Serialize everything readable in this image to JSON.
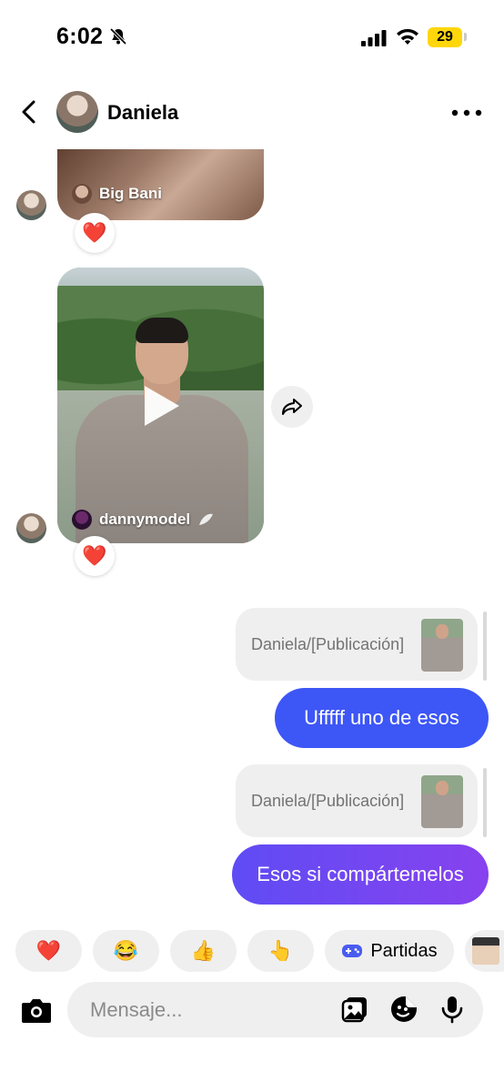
{
  "status_bar": {
    "time": "6:02",
    "battery": "29"
  },
  "header": {
    "contact_name": "Daniela"
  },
  "thread": {
    "shared_post_1": {
      "author": "Big Bani",
      "reaction": "❤️"
    },
    "shared_post_2": {
      "author": "dannymodel",
      "reaction": "❤️"
    },
    "sent_quote_1": {
      "text": "Daniela/[Publicación]"
    },
    "sent_message_1": {
      "text": "Ufffff uno de esos"
    },
    "sent_quote_2": {
      "text": "Daniela/[Publicación]"
    },
    "sent_message_2": {
      "text": "Esos si compártemelos"
    }
  },
  "quick_replies": {
    "items": [
      {
        "emoji": "❤️"
      },
      {
        "emoji": "😂"
      },
      {
        "emoji": "👍"
      },
      {
        "emoji": "👆"
      }
    ],
    "games_label": "Partidas"
  },
  "composer": {
    "placeholder": "Mensaje..."
  },
  "colors": {
    "bubble_gradient_start": "#3a5cf6",
    "bubble_gradient_end": "#8a3ff0",
    "chip_bg": "#efefef"
  }
}
